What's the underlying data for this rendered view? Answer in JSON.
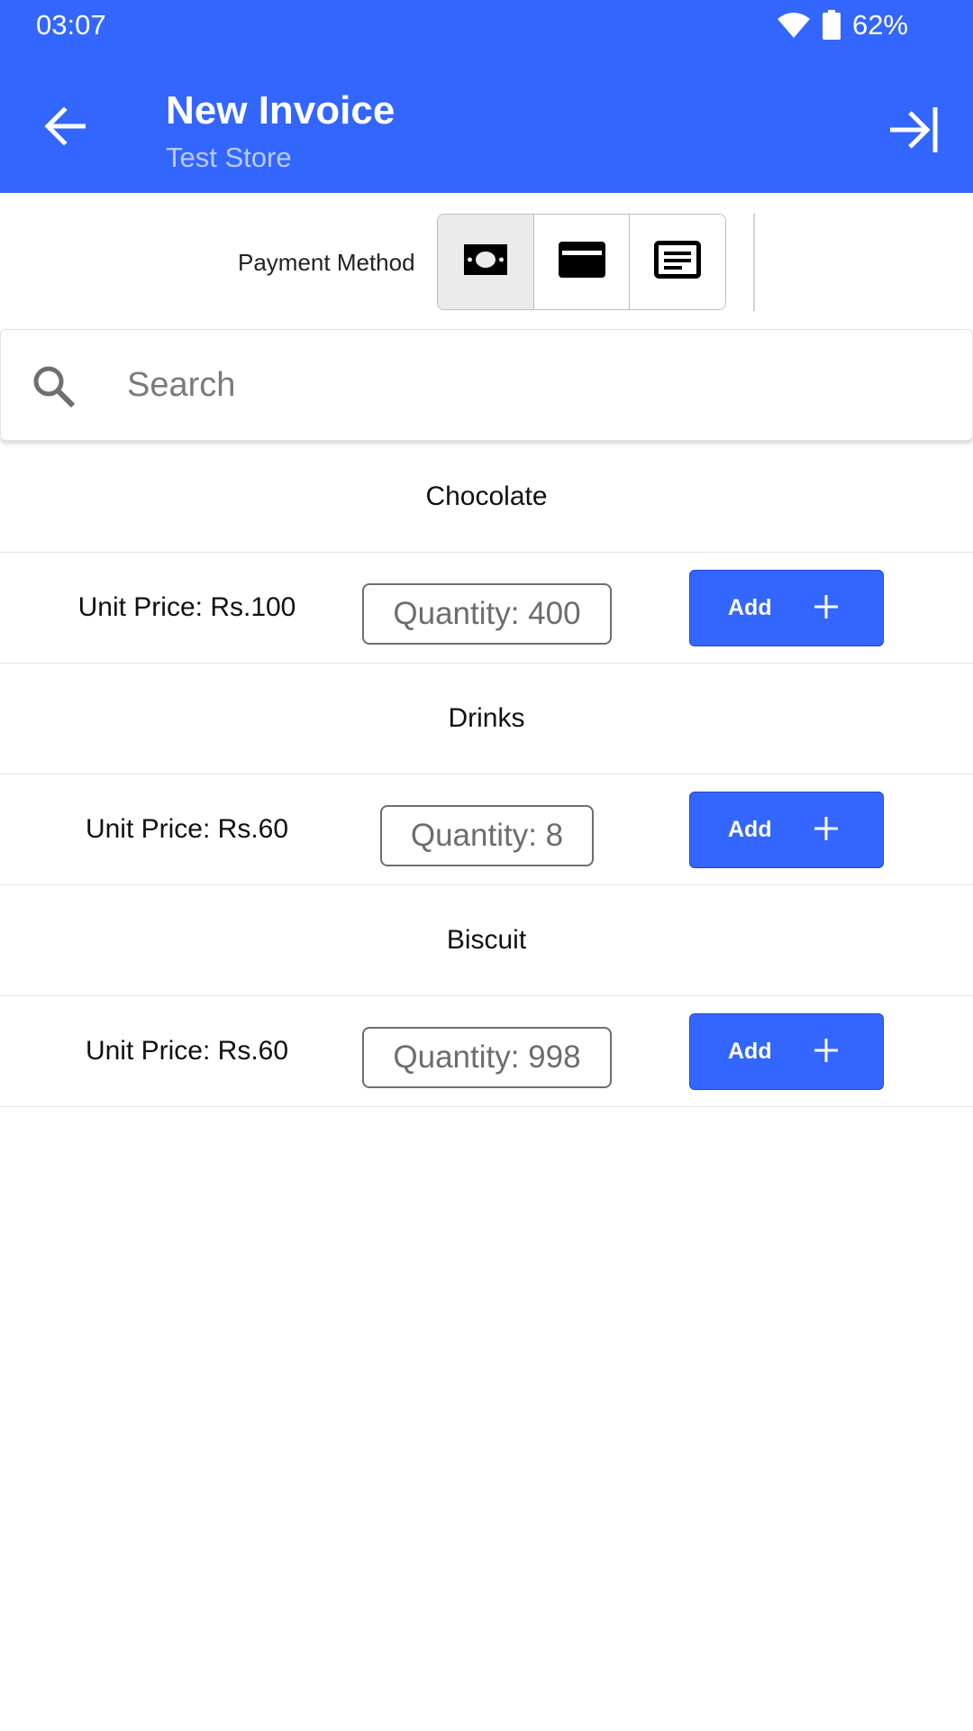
{
  "status_bar": {
    "time": "03:07",
    "battery": "62%",
    "icons": [
      "wifi-icon",
      "battery-icon"
    ]
  },
  "app_bar": {
    "title": "New Invoice",
    "subtitle": "Test Store",
    "back_icon": "arrow-left-icon",
    "exit_icon": "arrow-to-end-icon"
  },
  "payment": {
    "label": "Payment Method",
    "options": [
      {
        "icon": "cash-icon",
        "selected": true
      },
      {
        "icon": "card-icon",
        "selected": false
      },
      {
        "icon": "cheque-icon",
        "selected": false
      }
    ]
  },
  "search": {
    "placeholder": "Search",
    "icon": "search-icon"
  },
  "products": [
    {
      "name": "Chocolate",
      "price": "Unit Price: Rs.100",
      "quantity": "Quantity: 400",
      "add_label": "Add"
    },
    {
      "name": "Drinks",
      "price": "Unit Price: Rs.60",
      "quantity": "Quantity: 8",
      "add_label": "Add"
    },
    {
      "name": "Biscuit",
      "price": "Unit Price: Rs.60",
      "quantity": "Quantity: 998",
      "add_label": "Add"
    }
  ],
  "colors": {
    "primary": "#3366FF",
    "subtitle": "#B9CCFF",
    "selected_option": "#EBEBEB",
    "divider": "#E3E3E3"
  }
}
